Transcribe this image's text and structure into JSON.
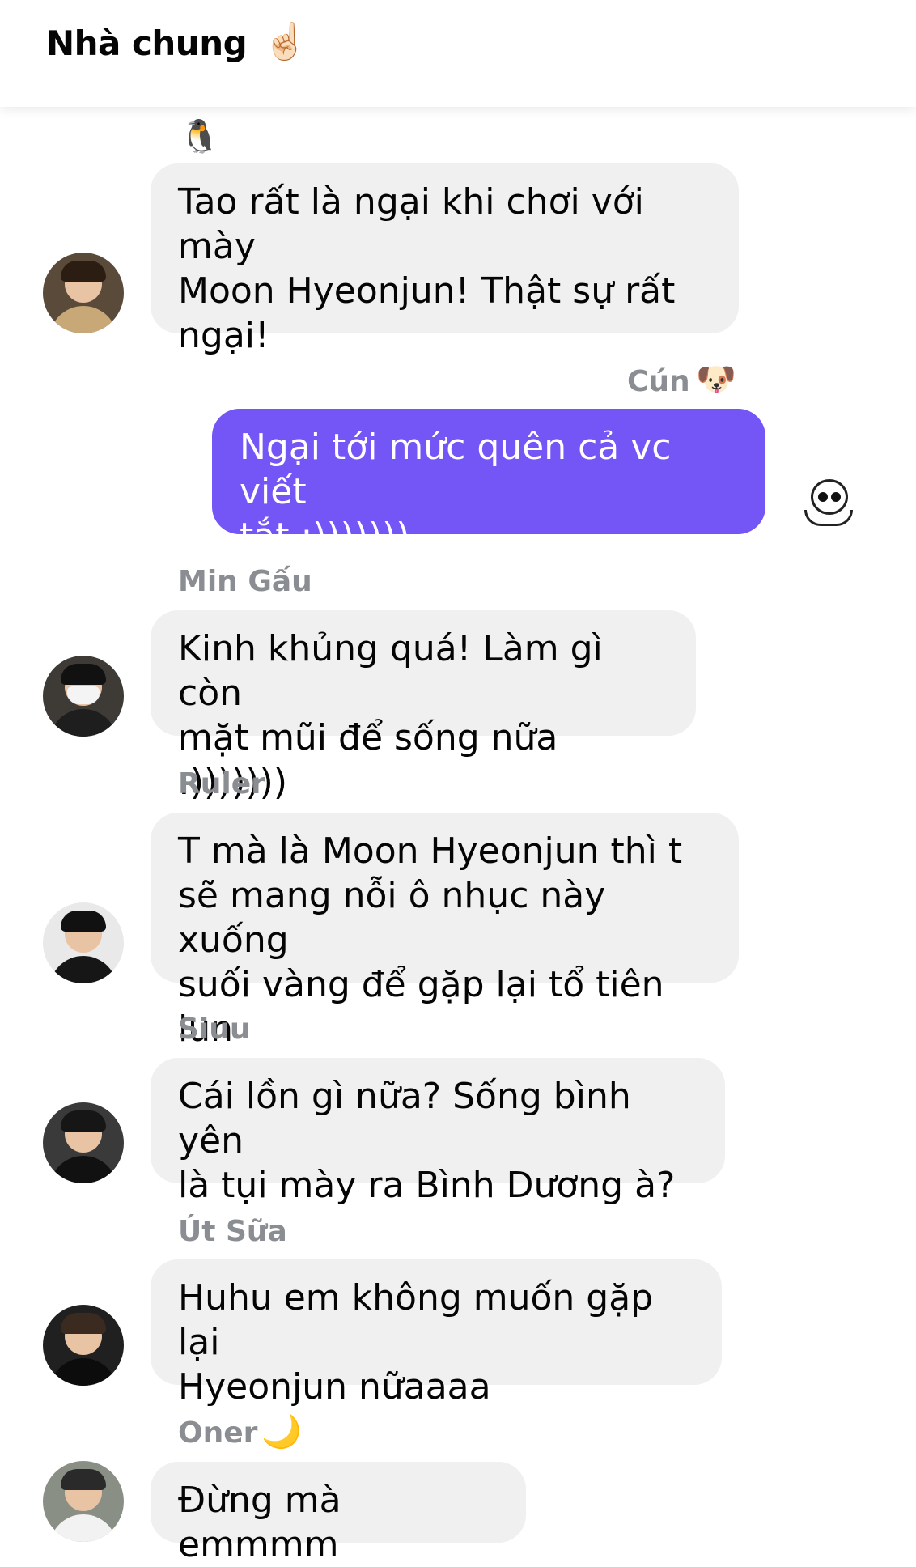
{
  "header": {
    "title": "Nhà chung",
    "emoji": "☝🏻",
    "emoji_name": "pointing-up-icon"
  },
  "messages": [
    {
      "sender": "",
      "sender_emoji": "🐧",
      "text": "Tao rất là ngại khi chơi với mày\nMoon Hyeonjun! Thật sự rất\nngại!",
      "outgoing": false
    },
    {
      "sender": "Cún",
      "sender_emoji": "🐶",
      "text": "Ngại tới mức quên cả vc viết\ntắt :)))))))",
      "outgoing": true
    },
    {
      "sender": "Min Gấu",
      "text": "Kinh khủng quá! Làm gì còn\nmặt mũi để sống nữa :)))))))",
      "outgoing": false
    },
    {
      "sender": "Ruler",
      "text": "T mà là Moon Hyeonjun thì t\nsẽ mang nỗi ô nhục này xuống\nsuối vàng để gặp lại tổ tiên lun",
      "outgoing": false
    },
    {
      "sender": "Siuu",
      "text": "Cái lồn gì nữa? Sống bình yên\nlà tụi mày ra Bình Dương à?",
      "outgoing": false
    },
    {
      "sender": "Út Sữa",
      "text": "Huhu em không muốn gặp lại\nHyeonjun nữaaaa",
      "outgoing": false
    },
    {
      "sender": "Oner",
      "sender_emoji": "🌙",
      "text": "Đừng mà emmmm",
      "outgoing": false
    }
  ],
  "colors": {
    "outgoing_bubble": "#7455f6",
    "incoming_bubble": "#f0f0f0",
    "sender_name": "#8a8d91"
  }
}
